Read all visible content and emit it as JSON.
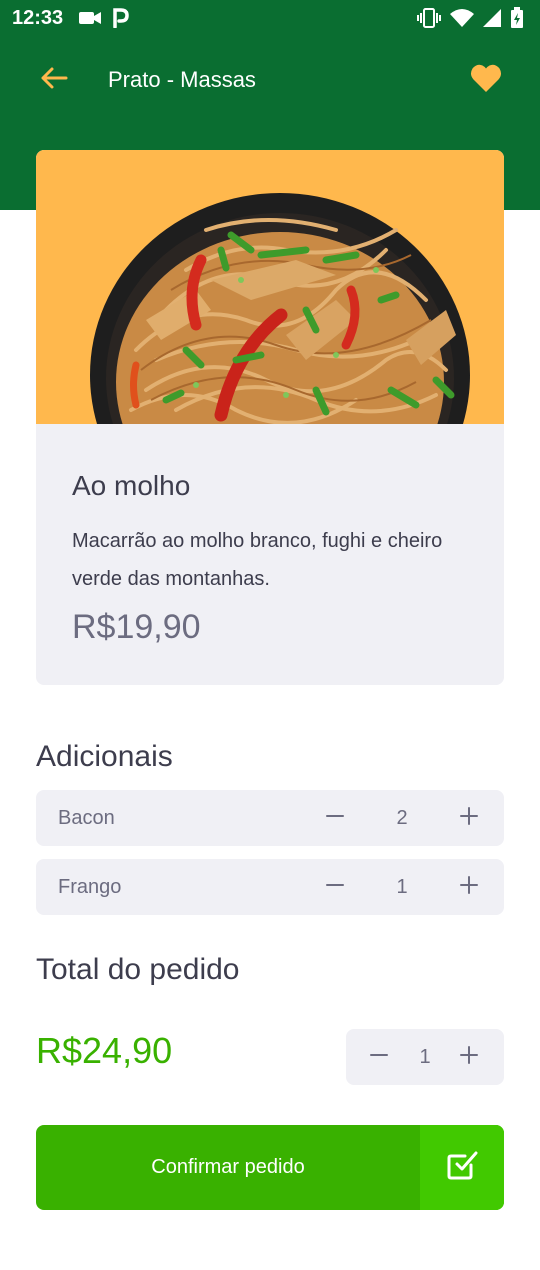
{
  "status_bar": {
    "time": "12:33",
    "left_icons": [
      "video-camera-icon",
      "parking-icon"
    ],
    "right_icons": [
      "vibrate-icon",
      "wifi-icon",
      "signal-icon",
      "battery-icon"
    ]
  },
  "header": {
    "title": "Prato - Massas",
    "back_icon": "arrow-left-icon",
    "favorite_icon": "heart-icon"
  },
  "product": {
    "image": "pasta-dish-image",
    "name": "Ao molho",
    "description": "Macarrão ao molho branco, fughi e cheiro verde das montanhas.",
    "price": "R$19,90"
  },
  "extras": {
    "title": "Adicionais",
    "items": [
      {
        "name": "Bacon",
        "quantity": "2"
      },
      {
        "name": "Frango",
        "quantity": "1"
      }
    ]
  },
  "order": {
    "title": "Total do pedido",
    "total": "R$24,90",
    "quantity": "1"
  },
  "confirm": {
    "label": "Confirmar pedido",
    "icon": "check-square-icon"
  },
  "colors": {
    "header_green": "#0a6e31",
    "accent_yellow": "#ffb84d",
    "price_green": "#39b100",
    "button_green": "#39b100",
    "button_icon_green": "#41c900",
    "card_bg": "#f0f0f5",
    "text_dark": "#3d3d4d",
    "text_muted": "#6c6c80"
  }
}
